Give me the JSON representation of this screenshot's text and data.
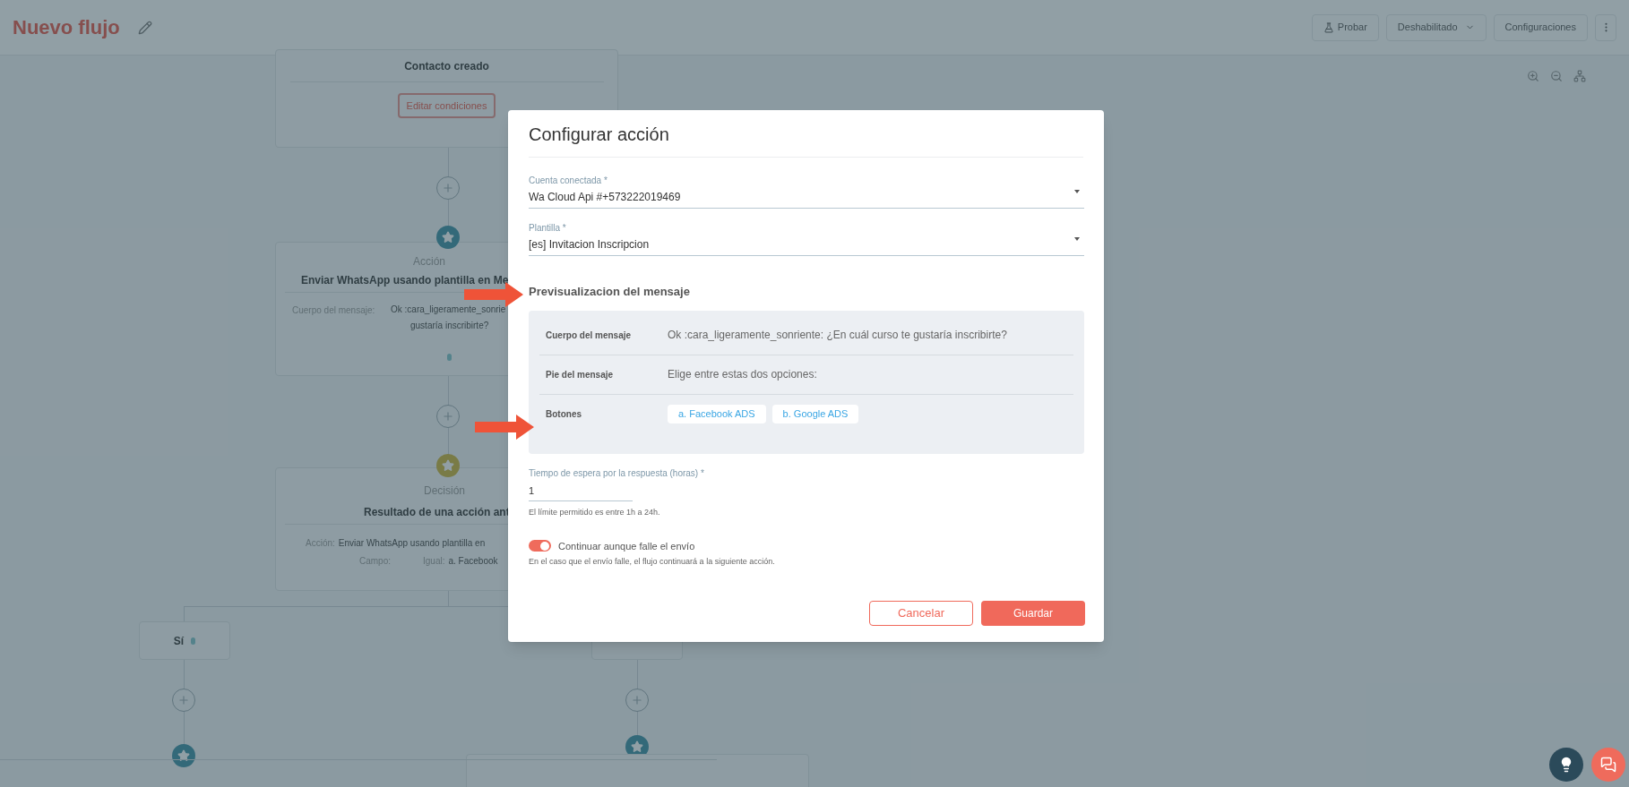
{
  "header": {
    "title": "Nuevo flujo",
    "actions": [
      {
        "kind": "test",
        "label": "Probar"
      },
      {
        "kind": "dropdown",
        "label": "Deshabilitado"
      },
      {
        "kind": "plain",
        "label": "Configuraciones"
      }
    ]
  },
  "flow": {
    "trigger": {
      "title": "Contacto creado",
      "button": "Editar condiciones"
    },
    "action": {
      "type": "Acción",
      "title": "Enviar WhatsApp usando plantilla en Me",
      "field_label": "Cuerpo del mensaje:",
      "value_line1": "Ok :cara_ligeramente_sonrie",
      "value_line2": "gustaría inscribirte?"
    },
    "decision": {
      "type": "Decisión",
      "title": "Resultado de una acción ant",
      "rows": [
        {
          "parts": [
            {
              "label": "Acción:",
              "value": "Enviar WhatsApp usando plantilla en"
            }
          ]
        },
        {
          "parts": [
            {
              "label": "Campo:"
            },
            {
              "label": "Igual:",
              "value": "a. Facebook"
            }
          ]
        }
      ]
    },
    "branch": {
      "label": "Sí"
    }
  },
  "modal": {
    "title": "Configurar acción",
    "fields": [
      {
        "label": "Cuenta conectada *",
        "value": "Wa Cloud Api #+573222019469"
      },
      {
        "label": "Plantilla *",
        "value": "[es] Invitacion Inscripcion"
      }
    ],
    "preview": {
      "heading": "Previsualizacion del mensaje",
      "rows": [
        {
          "kind": "text",
          "label": "Cuerpo del mensaje",
          "value": "Ok :cara_ligeramente_sonriente: ¿En cuál curso te gustaría inscribirte?"
        },
        {
          "kind": "text",
          "label": "Pie del mensaje",
          "value": "Elige entre estas dos opciones:"
        },
        {
          "kind": "buttons",
          "label": "Botones",
          "buttons": [
            "a. Facebook ADS",
            "b. Google ADS"
          ]
        }
      ]
    },
    "wait": {
      "label": "Tiempo de espera por la respuesta (horas) *",
      "value": "1",
      "hint": "El límite permitido es entre 1h a 24h."
    },
    "toggle": {
      "label": "Continuar aunque falle el envío",
      "on": true,
      "hint": "En el caso que el envío falle, el flujo continuará a la siguiente acción."
    },
    "buttons": [
      {
        "kind": "secondary",
        "label": "Cancelar"
      },
      {
        "kind": "primary",
        "label": "Guardar"
      }
    ]
  }
}
